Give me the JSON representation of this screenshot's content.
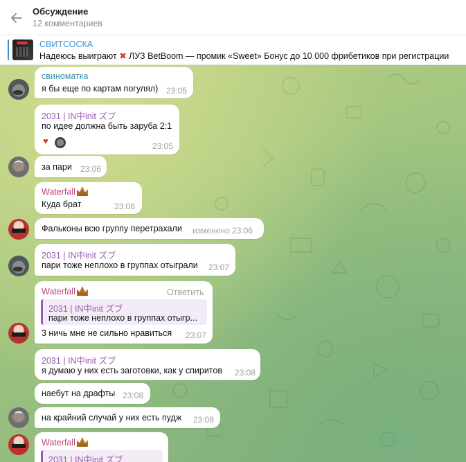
{
  "header": {
    "title": "Обсуждение",
    "subtitle": "12 комментариев"
  },
  "pinned": {
    "title": "СВИТСОСКА",
    "text_before": "Надеюсь выиграют ",
    "x_mark": "✖",
    "text_after": " ЛУЗ  BetBoom — промик «Sweet» Бонус до 10 000 фрибетиков при регистрации"
  },
  "messages": [
    {
      "sender": "свиноматка",
      "text": "я бы еще по картам погулял)",
      "time": "23:05"
    },
    {
      "sender": "2031 | IN中init ズブ",
      "text": "по идее должна быть заруба 2:1",
      "time": "23:05",
      "reaction": "♥"
    },
    {
      "text": "за пари",
      "time": "23:06"
    },
    {
      "sender": "Waterfall",
      "text": "Куда брат",
      "time": "23:06"
    },
    {
      "text": "Фальконы всю группу перетрахали",
      "time": "изменено 23:06"
    },
    {
      "sender": "2031 | IN中init ズブ",
      "text": "пари тоже неплохо в группах отыграли",
      "time": "23:07"
    },
    {
      "sender": "Waterfall",
      "reply_action": "Ответить",
      "reply_name": "2031 | IN中init ズブ",
      "reply_text": "пари тоже неплохо в группах отыгр...",
      "text": "3 ничь мне не сильно нравиться",
      "time": "23:07"
    },
    {
      "sender": "2031 | IN中init ズブ",
      "text": "я думаю у них есть заготовки, как у спиритов",
      "time": "23:08"
    },
    {
      "text": "наебут на драфты",
      "time": "23:08"
    },
    {
      "text": "на крайний случай у них есть пудж",
      "time": "23:08"
    },
    {
      "sender": "Waterfall",
      "reply_name": "2031 | IN中init ズブ"
    }
  ],
  "colors": {
    "sender_blue": "#3a8fab",
    "sender_purple": "#9a5ab3",
    "sender_pink": "#c0407a",
    "accent": "#3a8fd6"
  }
}
